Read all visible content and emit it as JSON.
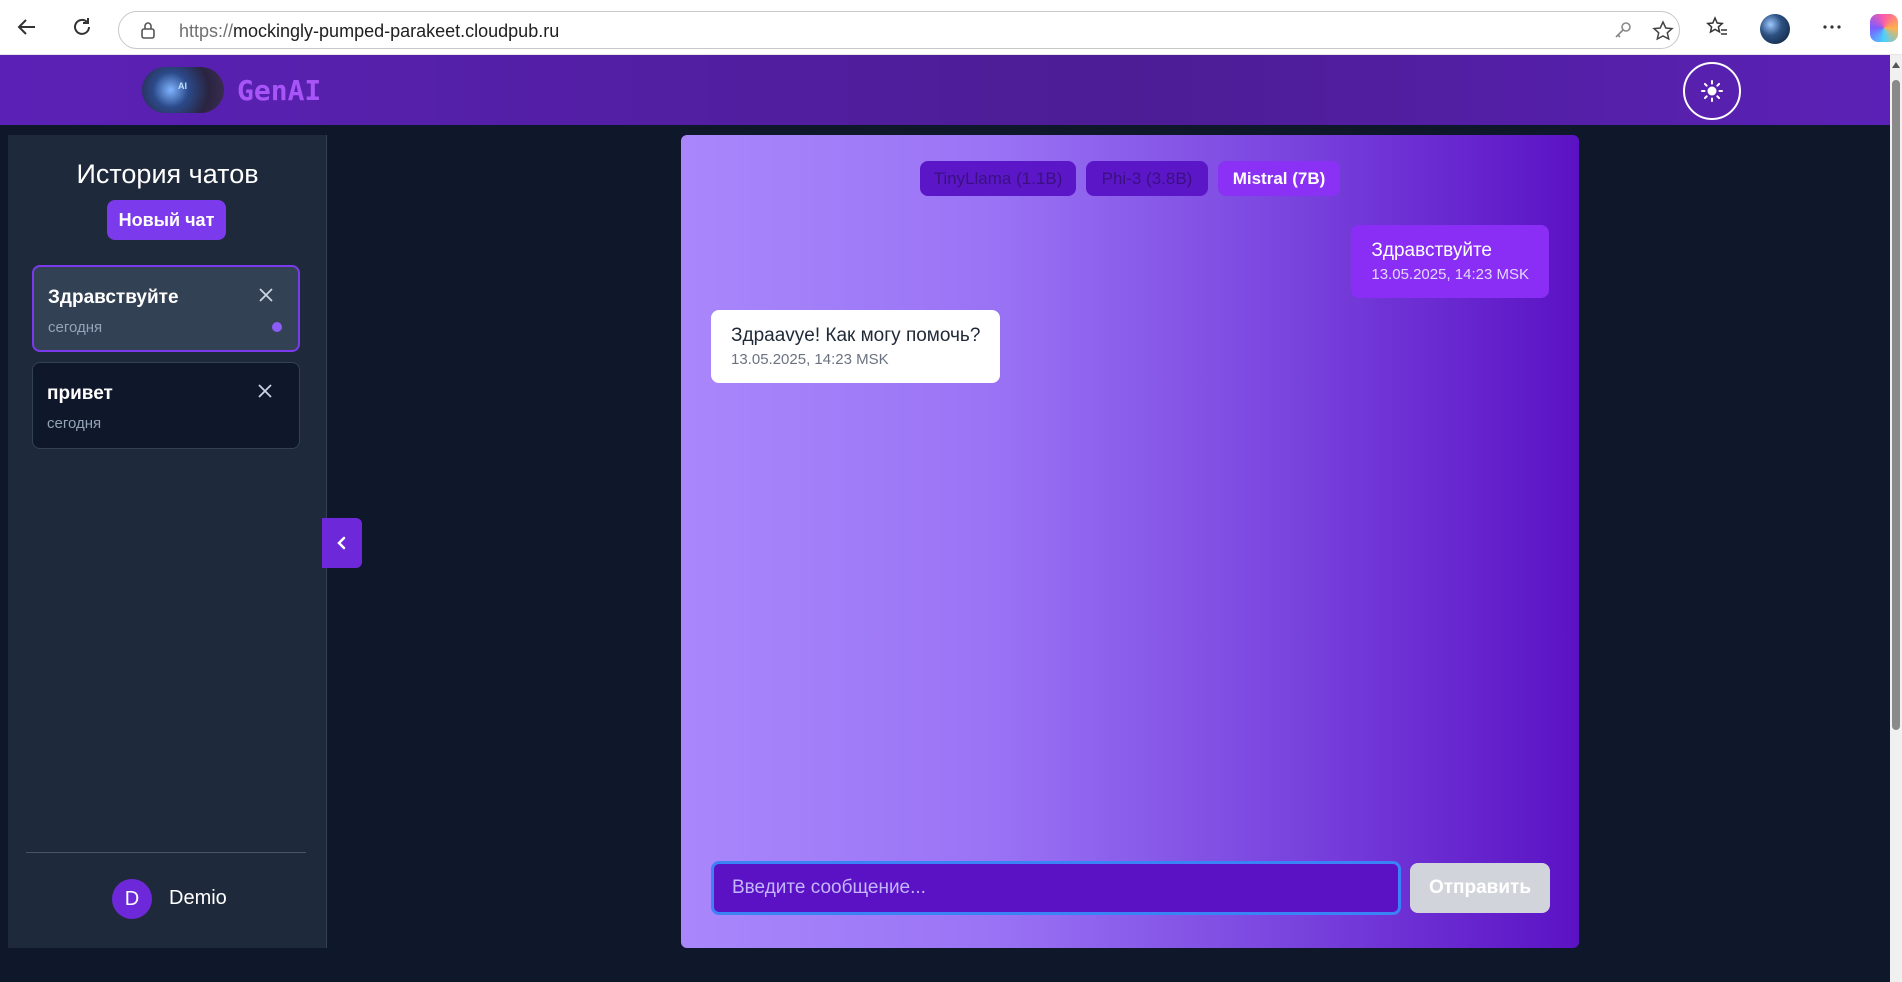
{
  "browser": {
    "url_scheme": "https://",
    "url_host": "mockingly-pumped-parakeet.cloudpub.ru"
  },
  "header": {
    "brand": "GenAI",
    "logo_text": "AI"
  },
  "sidebar": {
    "title": "История чатов",
    "new_chat_label": "Новый чат",
    "chats": [
      {
        "title": "Здравствуйте",
        "date": "сегодня",
        "active": true
      },
      {
        "title": "привет",
        "date": "сегодня",
        "active": false
      }
    ],
    "user": {
      "initial": "D",
      "name": "Demio"
    }
  },
  "models": [
    {
      "label": "TinyLlama (1.1B)",
      "selected": false
    },
    {
      "label": "Phi-3 (3.8B)",
      "selected": false
    },
    {
      "label": "Mistral (7B)",
      "selected": true
    }
  ],
  "messages": [
    {
      "role": "user",
      "text": "Здравствуйте",
      "time": "13.05.2025, 14:23 MSK"
    },
    {
      "role": "assistant",
      "text": "Здpaavye! Как могу помочь?",
      "time": "13.05.2025, 14:23 MSK"
    }
  ],
  "composer": {
    "placeholder": "Введите сообщение...",
    "send_label": "Отправить"
  },
  "colors": {
    "accent": "#7c3aed",
    "header": "#5b21b6",
    "page_bg": "#0f172a",
    "sidebar_bg": "#1e293b",
    "user_bubble": "#8b2ef5",
    "input_focus": "#3b82f6"
  }
}
